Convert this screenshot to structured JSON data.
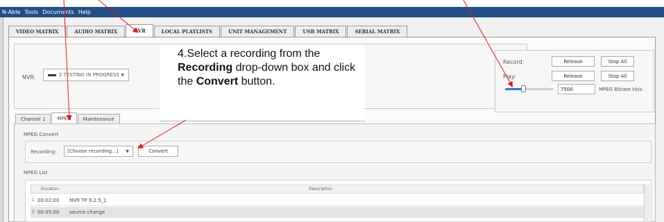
{
  "menu": [
    "N-Able",
    "Tools",
    "Documents",
    "Help"
  ],
  "main_tabs": [
    {
      "label": "VIDEO MATRIX",
      "active": false
    },
    {
      "label": "AUDIO MATRIX",
      "active": false
    },
    {
      "label": "NVR",
      "active": true
    },
    {
      "label": "LOCAL PLAYLISTS",
      "active": false
    },
    {
      "label": "UNIT MANAGEMENT",
      "active": false
    },
    {
      "label": "USB MATRIX",
      "active": false
    },
    {
      "label": "SERIAL MATRIX",
      "active": false
    }
  ],
  "nvr": {
    "label": "NVR:",
    "selected": "2 TESTING IN PROGRESS"
  },
  "controls": {
    "record_label": "Record:",
    "play_label": "Play:",
    "release": "Release",
    "stop_all": "Stop All",
    "bitrate_value": "7500",
    "bitrate_unit": "MPEG Bitrate kb/s",
    "slider_level": 0.37
  },
  "callout": {
    "prefix": "4.Select a recording from the ",
    "bold1": "Recording",
    "middle": " drop-down box and click the ",
    "bold2": "Convert",
    "suffix": " button."
  },
  "sub_tabs": [
    {
      "label": "Channel 1",
      "active": false
    },
    {
      "label": "MPEG",
      "active": true
    },
    {
      "label": "Maintenance",
      "active": false
    }
  ],
  "mpeg_convert": {
    "title": "MPEG Convert",
    "recording_label": "Recording:",
    "recording_selected": "[Choose recording...]",
    "convert_button": "Convert"
  },
  "mpeg_list": {
    "title": "MPEG List",
    "columns": [
      "Duration",
      "Description"
    ],
    "rows": [
      {
        "n": "1",
        "duration": "00:02:00",
        "description": "NVR TP 9.2.5_1"
      },
      {
        "n": "2",
        "duration": "00:05:00",
        "description": "source change"
      }
    ]
  },
  "colors": {
    "menubar": "#1f4f86",
    "arrow": "#e8131b",
    "slider": "#2a7be4"
  }
}
